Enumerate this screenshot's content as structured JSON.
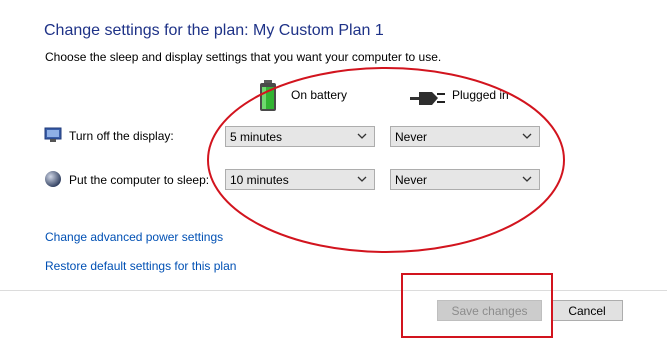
{
  "header": {
    "title": "Change settings for the plan: My Custom Plan 1",
    "subtitle": "Choose the sleep and display settings that you want your computer to use."
  },
  "columns": {
    "on_battery": "On battery",
    "plugged_in": "Plugged in",
    "on_battery_icon": "battery-icon",
    "plugged_in_icon": "power-plug-icon"
  },
  "rows": [
    {
      "label": "Turn off the display:",
      "icon": "display-icon",
      "battery_value": "5 minutes",
      "plugged_value": "Never"
    },
    {
      "label": "Put the computer to sleep:",
      "icon": "sleep-moon-icon",
      "battery_value": "10 minutes",
      "plugged_value": "Never"
    }
  ],
  "links": {
    "advanced": "Change advanced power settings",
    "restore": "Restore default settings for this plan"
  },
  "buttons": {
    "save": "Save changes",
    "cancel": "Cancel"
  },
  "colors": {
    "title": "#1e3287",
    "link": "#0050b4",
    "annotation": "#d2141e"
  }
}
